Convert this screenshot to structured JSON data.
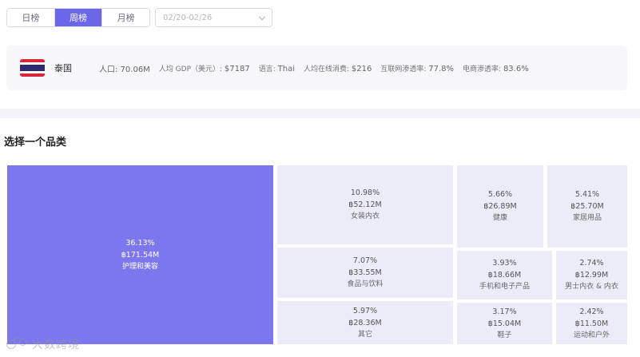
{
  "tabs": [
    {
      "label": "日榜",
      "active": false
    },
    {
      "label": "周榜",
      "active": true
    },
    {
      "label": "月榜",
      "active": false
    }
  ],
  "date_range": {
    "value": "02/20-02/26"
  },
  "country": {
    "name": "泰国",
    "flag_colors": {
      "red": "#d9263b",
      "white": "#ffffff",
      "blue": "#2d2a72"
    },
    "population": "人口: 70.06M",
    "gdp_label": "人均 GDP（美元）: ",
    "gdp_value": "$7187",
    "language_label": "语言: ",
    "language_value": "Thai",
    "spend_label": "人均在线消费: ",
    "spend_value": "$216",
    "internet_label": "互联网渗透率: ",
    "internet_value": "77.8%",
    "ecom_label": "电商渗透率: ",
    "ecom_value": "83.6%"
  },
  "section_title": "选择一个品类",
  "accent_color": "#7c77ee",
  "categories": [
    {
      "pct": "36.13%",
      "amount": "฿171.54M",
      "name": "护理和美容"
    },
    {
      "pct": "10.98%",
      "amount": "฿52.12M",
      "name": "女装内衣"
    },
    {
      "pct": "5.66%",
      "amount": "฿26.89M",
      "name": "健康"
    },
    {
      "pct": "5.41%",
      "amount": "฿25.70M",
      "name": "家居用品"
    },
    {
      "pct": "7.07%",
      "amount": "฿33.55M",
      "name": "食品与饮料"
    },
    {
      "pct": "3.93%",
      "amount": "฿18.66M",
      "name": "手机和电子产品"
    },
    {
      "pct": "2.74%",
      "amount": "฿12.99M",
      "name": "男士内衣 & 内衣"
    },
    {
      "pct": "5.97%",
      "amount": "฿28.36M",
      "name": "其它"
    },
    {
      "pct": "3.17%",
      "amount": "฿15.04M",
      "name": "鞋子"
    },
    {
      "pct": "2.42%",
      "amount": "฿11.50M",
      "name": "运动和户外"
    }
  ],
  "watermark": "大数跨境"
}
